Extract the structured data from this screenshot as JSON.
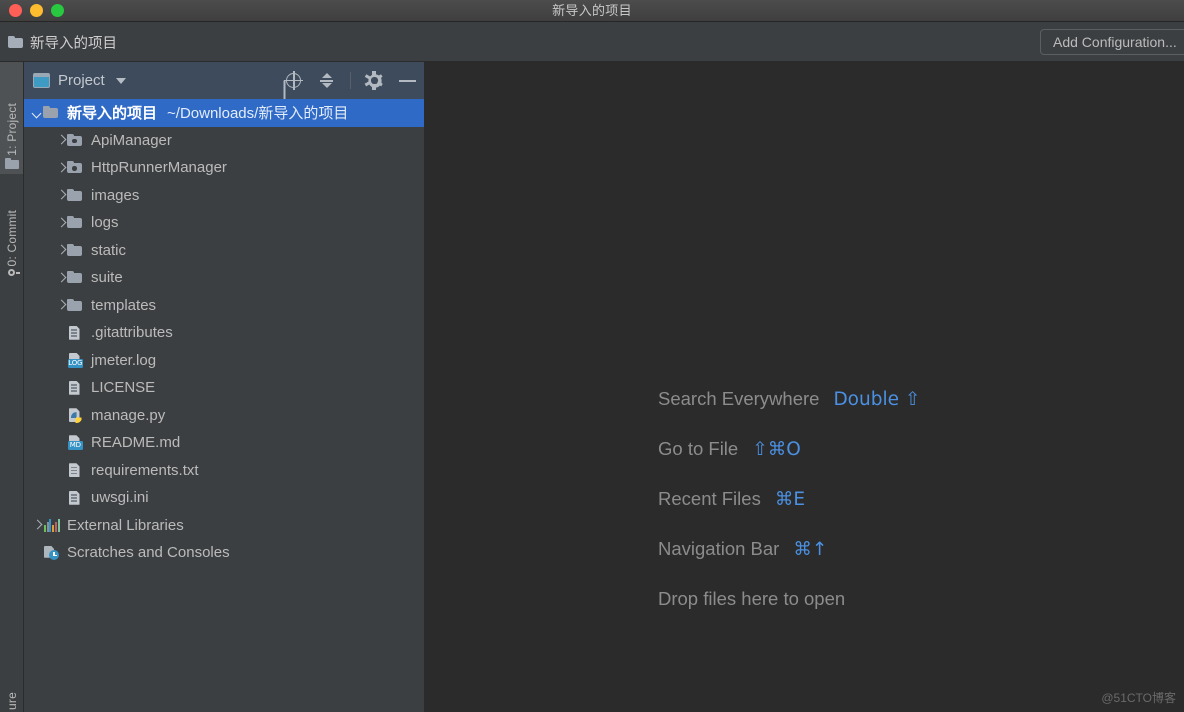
{
  "window": {
    "title": "新导入的项目",
    "traffic_lights": [
      "close-button",
      "minimize-button",
      "maximize-button"
    ]
  },
  "navbar": {
    "breadcrumb": "新导入的项目",
    "breadcrumb_icon": "folder-icon",
    "add_configuration": "Add Configuration..."
  },
  "toolstrip": {
    "items": [
      {
        "label": "1: Project",
        "icon": "project-folder-icon",
        "active": true
      },
      {
        "label": "0: Commit",
        "icon": "commit-icon",
        "active": false
      },
      {
        "label": "ure",
        "icon": "structure-icon",
        "active": false
      }
    ]
  },
  "project_panel": {
    "title": "Project",
    "title_icon": "project-window-icon",
    "dropdown_icon": "chevron-down-icon",
    "actions": [
      {
        "name": "select-opened-file-button",
        "icon": "target-icon"
      },
      {
        "name": "collapse-all-button",
        "icon": "collapse-all-icon"
      },
      {
        "name": "settings-button",
        "icon": "gear-icon"
      },
      {
        "name": "hide-button",
        "icon": "minus-icon"
      }
    ],
    "tree": [
      {
        "label": "新导入的项目",
        "path": "~/Downloads/新导入的项目",
        "icon": "folder",
        "arrow": "down",
        "indent": 0,
        "selected": true
      },
      {
        "label": "ApiManager",
        "icon": "source-folder",
        "arrow": "right",
        "indent": 1,
        "selected": false
      },
      {
        "label": "HttpRunnerManager",
        "icon": "source-folder",
        "arrow": "right",
        "indent": 1,
        "selected": false
      },
      {
        "label": "images",
        "icon": "folder",
        "arrow": "right",
        "indent": 1,
        "selected": false
      },
      {
        "label": "logs",
        "icon": "folder",
        "arrow": "right",
        "indent": 1,
        "selected": false
      },
      {
        "label": "static",
        "icon": "folder",
        "arrow": "right",
        "indent": 1,
        "selected": false
      },
      {
        "label": "suite",
        "icon": "folder",
        "arrow": "right",
        "indent": 1,
        "selected": false
      },
      {
        "label": "templates",
        "icon": "folder",
        "arrow": "right",
        "indent": 1,
        "selected": false
      },
      {
        "label": ".gitattributes",
        "icon": "text-file",
        "arrow": "none",
        "indent": 1,
        "selected": false
      },
      {
        "label": "jmeter.log",
        "icon": "log-file",
        "badge": "LOG",
        "arrow": "none",
        "indent": 1,
        "selected": false
      },
      {
        "label": "LICENSE",
        "icon": "text-file",
        "arrow": "none",
        "indent": 1,
        "selected": false
      },
      {
        "label": "manage.py",
        "icon": "python-file",
        "arrow": "none",
        "indent": 1,
        "selected": false
      },
      {
        "label": "README.md",
        "icon": "markdown-file",
        "badge": "MD",
        "arrow": "none",
        "indent": 1,
        "selected": false
      },
      {
        "label": "requirements.txt",
        "icon": "text-file",
        "arrow": "none",
        "indent": 1,
        "selected": false
      },
      {
        "label": "uwsgi.ini",
        "icon": "text-file",
        "arrow": "none",
        "indent": 1,
        "selected": false
      },
      {
        "label": "External Libraries",
        "icon": "libraries",
        "arrow": "right",
        "indent": 0,
        "selected": false
      },
      {
        "label": "Scratches and Consoles",
        "icon": "scratches",
        "arrow": "none",
        "indent": 0,
        "selected": false
      }
    ]
  },
  "editor": {
    "hints": [
      {
        "label": "Search Everywhere",
        "shortcut": "Double ⇧"
      },
      {
        "label": "Go to File",
        "shortcut": "⇧⌘O"
      },
      {
        "label": "Recent Files",
        "shortcut": "⌘E"
      },
      {
        "label": "Navigation Bar",
        "shortcut": "⌘↑"
      },
      {
        "label": "Drop files here to open",
        "shortcut": ""
      }
    ]
  },
  "watermark": "@51CTO博客",
  "colors": {
    "editor_background": "#2b2b2b",
    "panel_background": "#3c3f41",
    "panel_header": "#3d4b5c",
    "selection_blue": "#2f6ac7",
    "shortcut_blue": "#4b90e2",
    "text_primary": "#bbbbbb",
    "hint_text": "#8c8c8c"
  }
}
